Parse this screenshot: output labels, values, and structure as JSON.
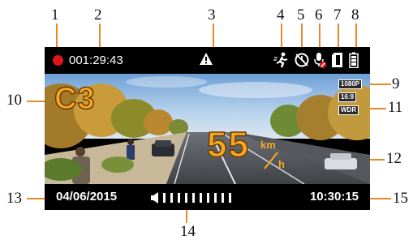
{
  "callouts": {
    "c1": "1",
    "c2": "2",
    "c3": "3",
    "c4": "4",
    "c5": "5",
    "c6": "6",
    "c7": "7",
    "c8": "8",
    "c9": "9",
    "c10": "10",
    "c11": "11",
    "c12": "12",
    "c13": "13",
    "c14": "14",
    "c15": "15"
  },
  "status_bar": {
    "record_time": "001:29:43",
    "icons": [
      "record-dot-icon",
      "warning-triangle-icon",
      "motion-detection-icon",
      "timer-icon",
      "mic-muted-icon",
      "sd-card-icon",
      "battery-icon"
    ]
  },
  "scene": {
    "mode": "C3",
    "resolution": "1080P",
    "aspect": "16:9",
    "wdr": "WDR",
    "speed": "55",
    "speed_unit_top": "km",
    "speed_unit_bottom": "h"
  },
  "bottom_bar": {
    "date": "04/06/2015",
    "time": "10:30:15",
    "volume_level": 10
  },
  "colors": {
    "accent": "#f5a623",
    "leader": "#e8892a",
    "record": "#e0141b",
    "bar": "#000000"
  }
}
